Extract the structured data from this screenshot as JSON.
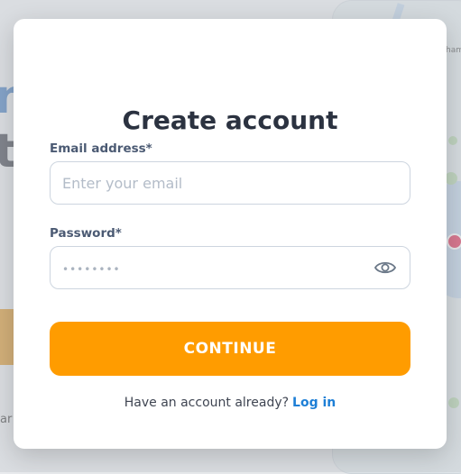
{
  "modal": {
    "title": "Create account",
    "email_label": "Email address*",
    "email_placeholder": "Enter your email",
    "email_value": "",
    "password_label": "Password*",
    "password_placeholder": "••••••••",
    "password_value": "",
    "toggle_icon": "eye-icon",
    "continue_label": "CONTINUE",
    "footer_text": "Have an account already?",
    "login_link": "Log in"
  },
  "background": {
    "hero_line1": "ne",
    "hero_line2": "t",
    "small_text": "ar",
    "map_label": "ham"
  },
  "colors": {
    "accent": "#ff9c00",
    "link": "#1e7fd6",
    "title": "#2b3240",
    "label": "#4b5a73"
  }
}
